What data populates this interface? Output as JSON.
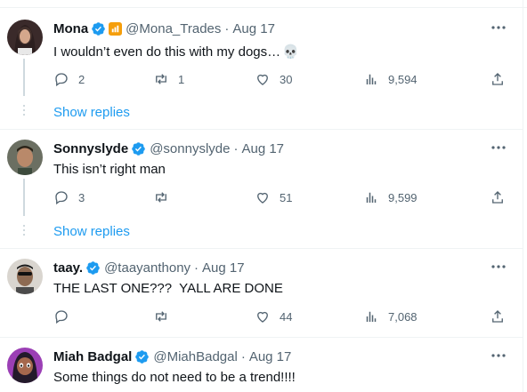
{
  "replies": [
    {
      "name": "Mona",
      "handle": "@Mona_Trades",
      "date": "Aug 17",
      "text": "I wouldn’t even do this with my dogs…",
      "emoji": "💀",
      "has_badge": true,
      "stats": {
        "replies": "2",
        "reposts": "1",
        "likes": "30",
        "views": "9,594"
      },
      "show_replies": "Show replies"
    },
    {
      "name": "Sonnyslyde",
      "handle": "@sonnyslyde",
      "date": "Aug 17",
      "text": "This isn’t right man",
      "stats": {
        "replies": "3",
        "reposts": "",
        "likes": "51",
        "views": "9,599"
      },
      "show_replies": "Show replies"
    },
    {
      "name": "taay.",
      "handle": "@taayanthony",
      "date": "Aug 17",
      "text": "THE LAST ONE???  YALL ARE DONE",
      "stats": {
        "replies": "",
        "reposts": "",
        "likes": "44",
        "views": "7,068"
      }
    },
    {
      "name": "Miah Badgal",
      "handle": "@MiahBadgal",
      "date": "Aug 17",
      "text": "Some things do not need to be a trend!!!!"
    }
  ],
  "separator": "·",
  "colors": {
    "accent": "#1d9bf0",
    "muted": "#536471",
    "text": "#0f1419",
    "badge": "#f59e0b"
  }
}
